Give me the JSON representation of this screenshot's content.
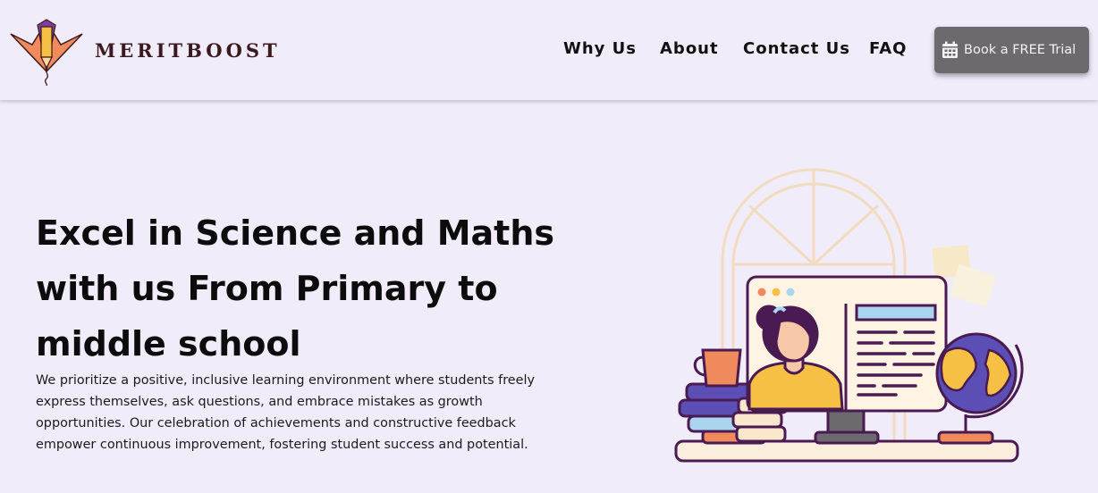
{
  "brand": {
    "name": "MERITBOOST",
    "logo_icon": "pencil-lotus-logo"
  },
  "nav": {
    "items": [
      {
        "label": "Why Us"
      },
      {
        "label": "About"
      },
      {
        "label": "Contact Us"
      },
      {
        "label": "FAQ"
      }
    ],
    "cta": {
      "label": "Book a FREE Trial",
      "icon": "calendar-icon"
    }
  },
  "hero": {
    "title_lines": [
      "Excel in Science and Maths",
      "with us From Primary to",
      "middle school"
    ],
    "description": "We prioritize a positive, inclusive learning environment where students freely express themselves, ask questions, and embrace mistakes as growth opportunities. Our celebration of achievements and constructive feedback empower continuous improvement, fostering student success and potential."
  },
  "colors": {
    "background": "#f1ecfa",
    "button": "#6c6a6f",
    "button_text": "#f3f3f3",
    "brand_text": "#3a1a1e",
    "outline": "#4a1a52",
    "accent_orange": "#f08a5d",
    "accent_yellow": "#f5c043",
    "accent_blue": "#5b4fb5"
  }
}
